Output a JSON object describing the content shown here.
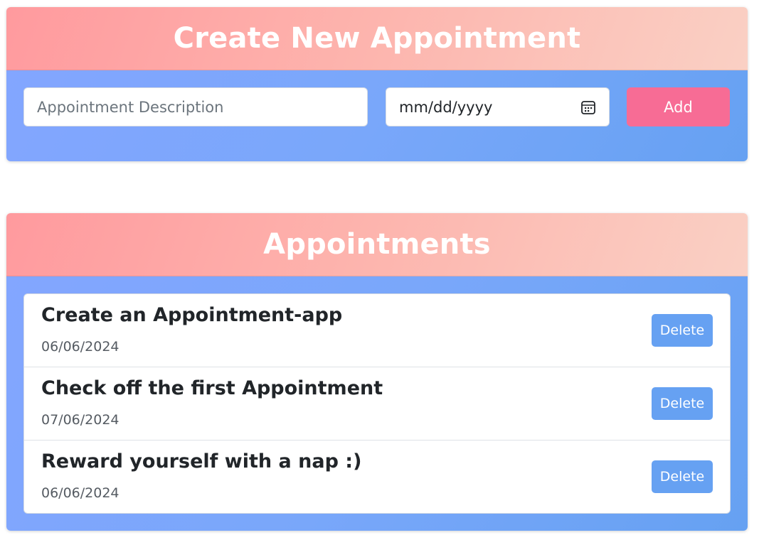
{
  "create": {
    "title": "Create New Appointment",
    "description_placeholder": "Appointment Description",
    "date_placeholder": "mm/dd/yyyy",
    "add_label": "Add"
  },
  "list": {
    "title": "Appointments",
    "delete_label": "Delete",
    "items": [
      {
        "title": "Create an Appointment-app",
        "date": "06/06/2024"
      },
      {
        "title": "Check off the first Appointment",
        "date": "07/06/2024"
      },
      {
        "title": "Reward yourself with a nap :)",
        "date": "06/06/2024"
      }
    ]
  },
  "colors": {
    "header_gradient_start": "#ff9a9e",
    "header_gradient_end": "#fad0c4",
    "body_blue": "#79a7fa",
    "add_button": "#f76c95",
    "delete_button": "#66a1f2"
  },
  "icons": {
    "date_picker": "calendar-icon"
  }
}
